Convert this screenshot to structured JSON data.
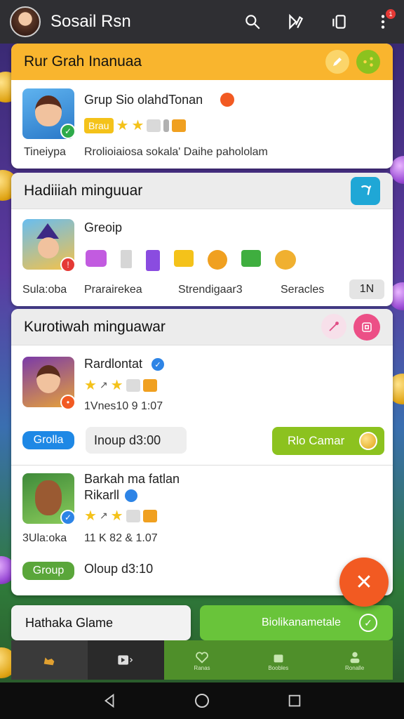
{
  "app": {
    "title": "Sosail Rsn"
  },
  "topbar": {
    "notification_count": "1"
  },
  "card1": {
    "header": "Rur Grah Inanuaa",
    "item": {
      "title": "Grup Sio olahdTonan",
      "tag": "Brau",
      "left_label": "Tineiypa",
      "desc": "Rrolioiaiosa sokala' Daihe pahololam"
    }
  },
  "card2": {
    "header": "Hadiiiah minguuar",
    "item": {
      "title": "Greoip",
      "labels": [
        "Sula:oba",
        "Prarairekea",
        "Strendigaar3",
        "Seracles"
      ],
      "count": "1N"
    }
  },
  "card3": {
    "header": "Kurotiwah minguawar",
    "item1": {
      "title": "Rardlontat",
      "meta": "1Vnes10 9  1:07",
      "tag": "Grolla",
      "field": "Inoup d3:00",
      "action": "Rlo Camar"
    },
    "item2": {
      "title_line1": "Barkah ma fatlan",
      "title_line2": "Rikarll",
      "left_label": "3Ula:oka",
      "meta": "11 K 82 &  1.07",
      "tag": "Group",
      "field": "Oloup d3:10"
    }
  },
  "bottom": {
    "left_label": "Hathaka Glame",
    "right_label": "Biolikanametale"
  },
  "tabs": [
    {
      "label": "Ranas"
    },
    {
      "label": "Boobles"
    },
    {
      "label": "Ronalle"
    }
  ],
  "colors": {
    "accent_orange": "#f9b52e",
    "accent_green": "#8cc21f",
    "fab": "#f25a22"
  }
}
